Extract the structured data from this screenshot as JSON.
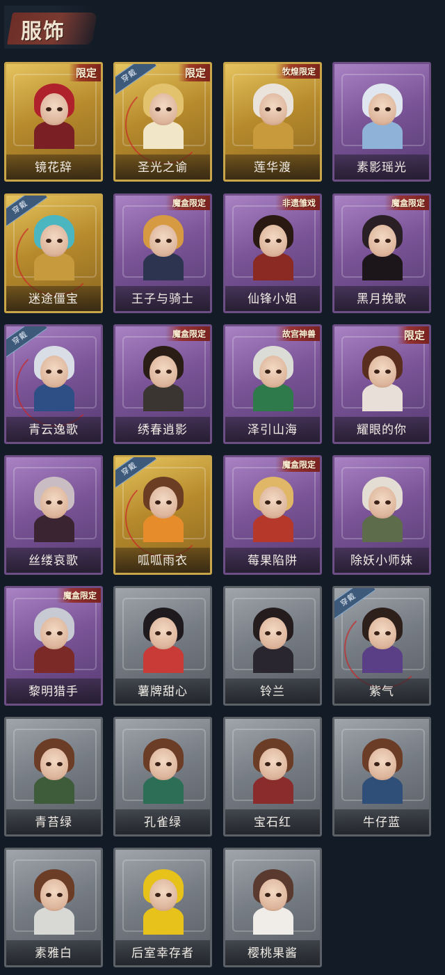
{
  "page": {
    "title": "服饰"
  },
  "wearing_label": "穿戴",
  "colors": {
    "gold_frame": "#c9a64a",
    "purple_frame": "#6d4f86",
    "gray_frame": "#5c6168",
    "tag_red": "#96281e",
    "wearing_blue": "#3d5a7a",
    "background": "#121b26"
  },
  "costumes": [
    {
      "name": "镜花辞",
      "rarity": "gold",
      "tag": "限定",
      "wearing": false,
      "hair": "#b0222b",
      "outfit": "#7a1f24"
    },
    {
      "name": "圣光之谕",
      "rarity": "gold",
      "tag": "限定",
      "wearing": true,
      "hair": "#e2c26c",
      "outfit": "#f1e6c8"
    },
    {
      "name": "莲华渡",
      "rarity": "gold",
      "tag": "牧煌限定",
      "wearing": false,
      "hair": "#e9e3dc",
      "outfit": "#c89a3c"
    },
    {
      "name": "素影瑶光",
      "rarity": "purple",
      "tag": "",
      "wearing": false,
      "hair": "#dfe6ef",
      "outfit": "#8fb2d8"
    },
    {
      "name": "迷途僵宝",
      "rarity": "gold",
      "tag": "",
      "wearing": true,
      "hair": "#4bb6c0",
      "outfit": "#c79a3e"
    },
    {
      "name": "王子与骑士",
      "rarity": "purple",
      "tag": "魔盒限定",
      "wearing": false,
      "hair": "#d69a43",
      "outfit": "#2c3450"
    },
    {
      "name": "仙锋小姐",
      "rarity": "purple",
      "tag": "非遗雏戏",
      "wearing": false,
      "hair": "#2a1812",
      "outfit": "#8b2a22"
    },
    {
      "name": "黑月挽歌",
      "rarity": "purple",
      "tag": "魔盒限定",
      "wearing": false,
      "hair": "#2a1f25",
      "outfit": "#1c1519"
    },
    {
      "name": "青云逸歌",
      "rarity": "purple",
      "tag": "",
      "wearing": true,
      "hair": "#d9dde6",
      "outfit": "#2e4f85"
    },
    {
      "name": "绣春逍影",
      "rarity": "purple",
      "tag": "魔盒限定",
      "wearing": false,
      "hair": "#2a1d16",
      "outfit": "#3a3531"
    },
    {
      "name": "泽引山海",
      "rarity": "purple",
      "tag": "故宫神兽",
      "wearing": false,
      "hair": "#dcdcd6",
      "outfit": "#2f7a4a"
    },
    {
      "name": "耀眼的你",
      "rarity": "purple",
      "tag": "限定",
      "wearing": false,
      "hair": "#5a2e1f",
      "outfit": "#e8e0d8"
    },
    {
      "name": "丝缕哀歌",
      "rarity": "purple",
      "tag": "",
      "wearing": false,
      "hair": "#c9bcc2",
      "outfit": "#3a2431"
    },
    {
      "name": "呱呱雨衣",
      "rarity": "gold",
      "tag": "",
      "wearing": true,
      "hair": "#6b3d22",
      "outfit": "#e78c2a"
    },
    {
      "name": "莓果陷阱",
      "rarity": "purple",
      "tag": "魔盒限定",
      "wearing": false,
      "hair": "#e0b667",
      "outfit": "#b5382a"
    },
    {
      "name": "除妖小师妹",
      "rarity": "purple",
      "tag": "",
      "wearing": false,
      "hair": "#e4ddd3",
      "outfit": "#5d6c4a"
    },
    {
      "name": "黎明猎手",
      "rarity": "purple",
      "tag": "魔盒限定",
      "wearing": false,
      "hair": "#c7cad2",
      "outfit": "#7b2a28"
    },
    {
      "name": "薯牌甜心",
      "rarity": "gray",
      "tag": "",
      "wearing": false,
      "hair": "#1e1a1d",
      "outfit": "#c83b36"
    },
    {
      "name": "铃兰",
      "rarity": "gray",
      "tag": "",
      "wearing": false,
      "hair": "#241c1d",
      "outfit": "#2a2630"
    },
    {
      "name": "紫气",
      "rarity": "gray",
      "tag": "",
      "wearing": true,
      "hair": "#2d1f1a",
      "outfit": "#5a3f86"
    },
    {
      "name": "青苔绿",
      "rarity": "gray",
      "tag": "",
      "wearing": false,
      "hair": "#6b3d26",
      "outfit": "#3f5c3a"
    },
    {
      "name": "孔雀绿",
      "rarity": "gray",
      "tag": "",
      "wearing": false,
      "hair": "#6b3d26",
      "outfit": "#2c6e56"
    },
    {
      "name": "宝石红",
      "rarity": "gray",
      "tag": "",
      "wearing": false,
      "hair": "#6b3d26",
      "outfit": "#8a2c2c"
    },
    {
      "name": "牛仔蓝",
      "rarity": "gray",
      "tag": "",
      "wearing": false,
      "hair": "#6b3d26",
      "outfit": "#2f4f78"
    },
    {
      "name": "素雅白",
      "rarity": "gray",
      "tag": "",
      "wearing": false,
      "hair": "#6b3d26",
      "outfit": "#d8d8d4"
    },
    {
      "name": "后室幸存者",
      "rarity": "gray",
      "tag": "",
      "wearing": false,
      "hair": "#e6c21b",
      "outfit": "#e6c21b"
    },
    {
      "name": "樱桃果酱",
      "rarity": "gray",
      "tag": "",
      "wearing": false,
      "hair": "#5a3a2e",
      "outfit": "#f0ede8"
    }
  ]
}
